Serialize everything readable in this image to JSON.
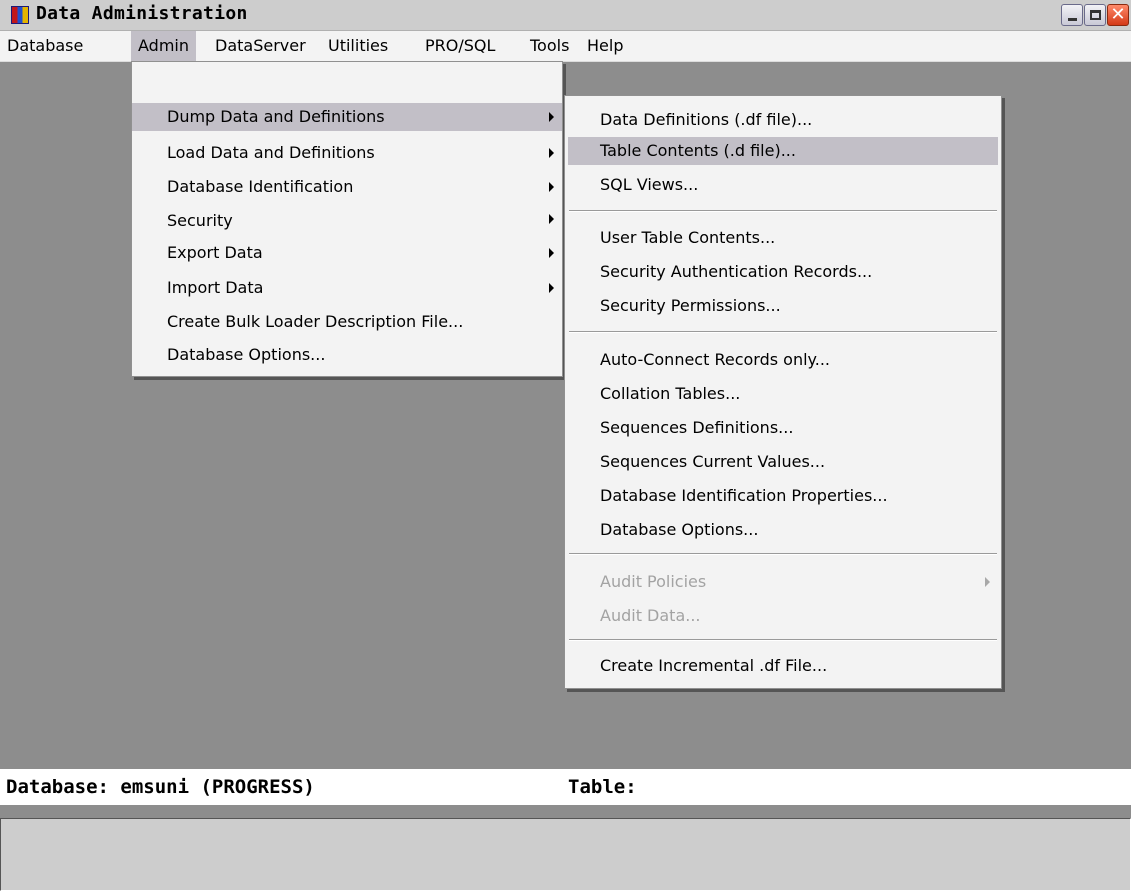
{
  "window": {
    "title": "Data Administration",
    "icon": "progress-app-icon",
    "controls": {
      "minimize": "minimize-icon",
      "maximize": "maximize-icon",
      "close": "close-icon"
    }
  },
  "menubar": {
    "items": [
      "Database",
      "Admin",
      "DataServer",
      "Utilities",
      "PRO/SQL",
      "Tools",
      "Help"
    ],
    "active": "Admin"
  },
  "admin_menu": {
    "items": [
      {
        "label": "Dump Data and Definitions",
        "submenu": true,
        "highlighted": true
      },
      {
        "label": "Load Data and Definitions",
        "submenu": true
      },
      {
        "label": "Database Identification",
        "submenu": true
      },
      {
        "label": "Security",
        "submenu": true
      },
      {
        "label": "Export Data",
        "submenu": true
      },
      {
        "label": "Import Data",
        "submenu": true
      },
      {
        "label": "Create Bulk Loader Description File...",
        "submenu": false
      },
      {
        "label": "Database Options...",
        "submenu": false
      }
    ]
  },
  "dump_submenu": {
    "groups": [
      [
        "Data Definitions (.df file)...",
        "Table Contents (.d file)...",
        "SQL Views..."
      ],
      [
        "User Table Contents...",
        "Security Authentication Records...",
        "Security Permissions..."
      ],
      [
        "Auto-Connect Records only...",
        "Collation Tables...",
        "Sequences Definitions...",
        "Sequences Current Values...",
        "Database Identification Properties...",
        "Database Options..."
      ],
      [
        "Audit Policies",
        "Audit Data..."
      ],
      [
        "Create Incremental .df File..."
      ]
    ],
    "highlighted": "Table Contents (.d file)...",
    "disabled": [
      "Audit Policies",
      "Audit Data..."
    ],
    "with_submenu": [
      "Audit Policies"
    ]
  },
  "status": {
    "database_label": "Database: emsuni (PROGRESS)",
    "table_label": "Table:"
  },
  "colors": {
    "workspace": "#8d8d8d",
    "menu_bg": "#f3f3f3",
    "highlight": "#c2bfc7",
    "disabled_text": "#a3a3a3"
  }
}
